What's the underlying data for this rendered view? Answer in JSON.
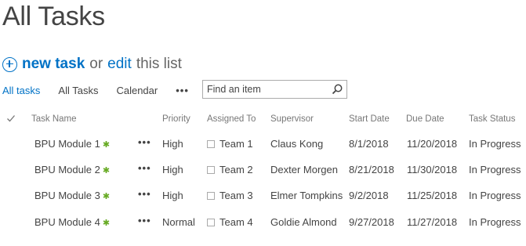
{
  "page": {
    "title": "All Tasks"
  },
  "actions": {
    "new_task": "new task",
    "or": "or",
    "edit": "edit",
    "this_list": "this list"
  },
  "views": {
    "items": [
      "All tasks",
      "All Tasks",
      "Calendar"
    ],
    "more": "•••"
  },
  "search": {
    "placeholder": "Find an item"
  },
  "table": {
    "columns": {
      "task_name": "Task Name",
      "priority": "Priority",
      "assigned_to": "Assigned To",
      "supervisor": "Supervisor",
      "start_date": "Start Date",
      "due_date": "Due Date",
      "task_status": "Task Status"
    },
    "rows": [
      {
        "task": "BPU Module 1",
        "new_icon": "✱",
        "dots": "•••",
        "priority": "High",
        "assigned": "Team 1",
        "supervisor": "Claus Kong",
        "start": "8/1/2018",
        "due": "11/20/2018",
        "status": "In Progress"
      },
      {
        "task": "BPU Module 2",
        "new_icon": "✱",
        "dots": "•••",
        "priority": "High",
        "assigned": "Team 2",
        "supervisor": "Dexter Morgen",
        "start": "8/21/2018",
        "due": "11/30/2018",
        "status": "In Progress"
      },
      {
        "task": "BPU Module 3",
        "new_icon": "✱",
        "dots": "•••",
        "priority": "High",
        "assigned": "Team 3",
        "supervisor": "Elmer Tompkins",
        "start": "9/2/2018",
        "due": "11/25/2018",
        "status": "In Progress"
      },
      {
        "task": "BPU Module 4",
        "new_icon": "✱",
        "dots": "•••",
        "priority": "Normal",
        "assigned": "Team 4",
        "supervisor": "Goldie Almond",
        "start": "9/27/2018",
        "due": "11/27/2018",
        "status": "In Progress"
      }
    ]
  },
  "colors": {
    "accent": "#0072c6",
    "text": "#444444",
    "muted": "#777777",
    "new_icon": "#66aa22"
  }
}
